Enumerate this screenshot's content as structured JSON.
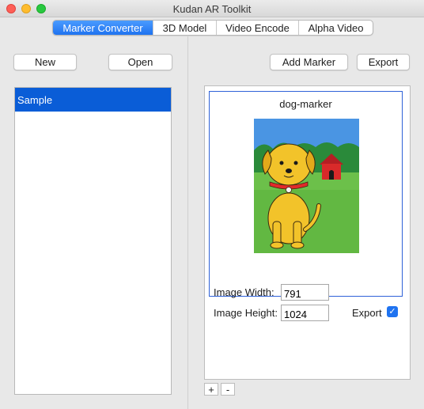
{
  "window": {
    "title": "Kudan AR Toolkit"
  },
  "tabs": [
    {
      "label": "Marker Converter",
      "active": true
    },
    {
      "label": "3D Model",
      "active": false
    },
    {
      "label": "Video Encode",
      "active": false
    },
    {
      "label": "Alpha Video",
      "active": false
    }
  ],
  "left": {
    "new_label": "New",
    "open_label": "Open",
    "items": [
      {
        "label": "Sample",
        "selected": true
      }
    ]
  },
  "right": {
    "add_marker_label": "Add Marker",
    "export_label": "Export",
    "marker": {
      "name": "dog-marker",
      "image_width_label": "Image Width:",
      "image_width_value": "791",
      "image_height_label": "Image Height:",
      "image_height_value": "1024",
      "export_label": "Export",
      "export_checked": true
    },
    "add_label": "+",
    "remove_label": "-"
  },
  "colors": {
    "accent": "#1f73f0",
    "selection": "#0a5dd7",
    "card_border": "#2f62d8"
  },
  "icons": {
    "export_checkbox": "checkmark-icon"
  }
}
